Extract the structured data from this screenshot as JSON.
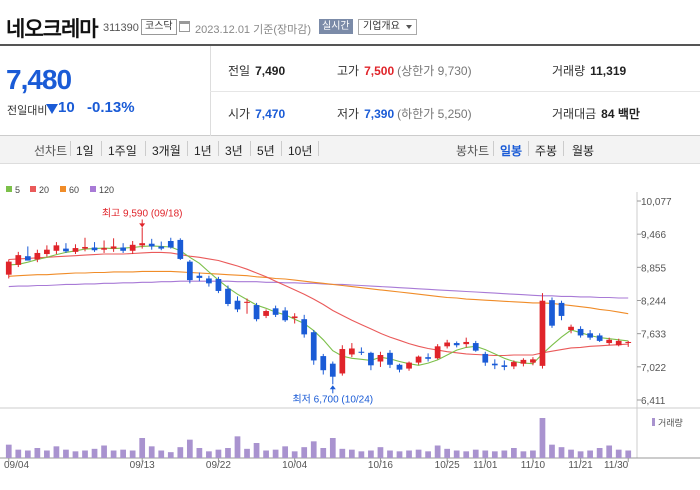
{
  "header": {
    "name": "네오크레마",
    "code": "311390",
    "market": "코스닥",
    "date": "2023.12.01 기준(장마감)",
    "realtime_label": "실시간",
    "corp_info_label": "기업개요"
  },
  "quote": {
    "price": "7,480",
    "change_label": "전일대비",
    "change": "10",
    "change_pct": "-0.13%",
    "direction": "down",
    "prev_close_label": "전일",
    "prev_close": "7,490",
    "high_label": "고가",
    "high": "7,500",
    "upper_limit": "(상한가 9,730)",
    "volume_label": "거래량",
    "volume": "11,319",
    "open_label": "시가",
    "open": "7,470",
    "low_label": "저가",
    "low": "7,390",
    "lower_limit": "(하한가 5,250)",
    "amount_label": "거래대금",
    "amount": "84 백만"
  },
  "period_bar": {
    "line_label": "선차트",
    "line_items": [
      "1일",
      "1주일",
      "3개월",
      "1년",
      "3년",
      "5년",
      "10년"
    ],
    "candle_label": "봉차트",
    "candle_items": [
      "일봉",
      "주봉",
      "월봉"
    ],
    "candle_active": "일봉"
  },
  "colors": {
    "up": "#e0242a",
    "down": "#1a5bd6",
    "ma5": "#7cc04a",
    "ma20": "#ea5a5a",
    "ma60": "#f08c28",
    "ma120": "#a87ad6",
    "volume": "#a993cf"
  },
  "chart_data": {
    "type": "candlestick",
    "legend": [
      {
        "name": "5",
        "color": "#7cc04a"
      },
      {
        "name": "20",
        "color": "#ea5a5a"
      },
      {
        "name": "60",
        "color": "#f08c28"
      },
      {
        "name": "120",
        "color": "#a87ad6"
      }
    ],
    "y_ticks": [
      "10,077",
      "9,466",
      "8,855",
      "8,244",
      "7,633",
      "7,022",
      "6,411"
    ],
    "ylim": [
      6411,
      10077
    ],
    "x_ticks": [
      "09/04",
      "09/13",
      "09/22",
      "10/04",
      "10/16",
      "10/25",
      "11/01",
      "11/10",
      "11/21",
      "11/30"
    ],
    "high_annotation": "최고 9,590 (09/18)",
    "low_annotation": "최저 6,700 (10/24)",
    "volume_label": "거래량",
    "candles": [
      {
        "o": 8720,
        "h": 9000,
        "l": 8650,
        "c": 8960
      },
      {
        "o": 8900,
        "h": 9140,
        "l": 8860,
        "c": 9080
      },
      {
        "o": 9060,
        "h": 9240,
        "l": 8980,
        "c": 8980
      },
      {
        "o": 9000,
        "h": 9180,
        "l": 8950,
        "c": 9120
      },
      {
        "o": 9100,
        "h": 9260,
        "l": 9050,
        "c": 9180
      },
      {
        "o": 9160,
        "h": 9320,
        "l": 9100,
        "c": 9260
      },
      {
        "o": 9200,
        "h": 9300,
        "l": 9120,
        "c": 9150
      },
      {
        "o": 9140,
        "h": 9280,
        "l": 9100,
        "c": 9210
      },
      {
        "o": 9200,
        "h": 9400,
        "l": 9150,
        "c": 9230
      },
      {
        "o": 9220,
        "h": 9320,
        "l": 9140,
        "c": 9170
      },
      {
        "o": 9180,
        "h": 9350,
        "l": 9120,
        "c": 9210
      },
      {
        "o": 9200,
        "h": 9390,
        "l": 9140,
        "c": 9240
      },
      {
        "o": 9220,
        "h": 9300,
        "l": 9120,
        "c": 9160
      },
      {
        "o": 9160,
        "h": 9340,
        "l": 9100,
        "c": 9270
      },
      {
        "o": 9260,
        "h": 9590,
        "l": 9200,
        "c": 9300
      },
      {
        "o": 9290,
        "h": 9380,
        "l": 9180,
        "c": 9240
      },
      {
        "o": 9240,
        "h": 9330,
        "l": 9170,
        "c": 9200
      },
      {
        "o": 9340,
        "h": 9400,
        "l": 9200,
        "c": 9220
      },
      {
        "o": 9360,
        "h": 9390,
        "l": 8990,
        "c": 9010
      },
      {
        "o": 8960,
        "h": 8990,
        "l": 8560,
        "c": 8620
      },
      {
        "o": 8700,
        "h": 8760,
        "l": 8600,
        "c": 8660
      },
      {
        "o": 8650,
        "h": 8700,
        "l": 8500,
        "c": 8560
      },
      {
        "o": 8640,
        "h": 8680,
        "l": 8380,
        "c": 8420
      },
      {
        "o": 8460,
        "h": 8520,
        "l": 8140,
        "c": 8180
      },
      {
        "o": 8240,
        "h": 8320,
        "l": 8030,
        "c": 8080
      },
      {
        "o": 8200,
        "h": 8280,
        "l": 8000,
        "c": 8220
      },
      {
        "o": 8160,
        "h": 8200,
        "l": 7860,
        "c": 7900
      },
      {
        "o": 7960,
        "h": 8080,
        "l": 7920,
        "c": 8050
      },
      {
        "o": 8100,
        "h": 8150,
        "l": 7940,
        "c": 7980
      },
      {
        "o": 8060,
        "h": 8120,
        "l": 7850,
        "c": 7880
      },
      {
        "o": 7920,
        "h": 8010,
        "l": 7820,
        "c": 7950
      },
      {
        "o": 7900,
        "h": 7980,
        "l": 7560,
        "c": 7620
      },
      {
        "o": 7660,
        "h": 7700,
        "l": 7060,
        "c": 7140
      },
      {
        "o": 7220,
        "h": 7260,
        "l": 6880,
        "c": 6960
      },
      {
        "o": 7080,
        "h": 7120,
        "l": 6700,
        "c": 6840
      },
      {
        "o": 6900,
        "h": 7420,
        "l": 6860,
        "c": 7350
      },
      {
        "o": 7250,
        "h": 7460,
        "l": 7200,
        "c": 7360
      },
      {
        "o": 7300,
        "h": 7380,
        "l": 7240,
        "c": 7280
      },
      {
        "o": 7280,
        "h": 7300,
        "l": 6960,
        "c": 7050
      },
      {
        "o": 7120,
        "h": 7300,
        "l": 7020,
        "c": 7240
      },
      {
        "o": 7280,
        "h": 7330,
        "l": 7000,
        "c": 7060
      },
      {
        "o": 7060,
        "h": 7080,
        "l": 6920,
        "c": 6970
      },
      {
        "o": 6990,
        "h": 7120,
        "l": 6950,
        "c": 7100
      },
      {
        "o": 7100,
        "h": 7230,
        "l": 7060,
        "c": 7210
      },
      {
        "o": 7200,
        "h": 7270,
        "l": 7120,
        "c": 7170
      },
      {
        "o": 7180,
        "h": 7440,
        "l": 7160,
        "c": 7400
      },
      {
        "o": 7400,
        "h": 7520,
        "l": 7360,
        "c": 7470
      },
      {
        "o": 7460,
        "h": 7490,
        "l": 7380,
        "c": 7420
      },
      {
        "o": 7440,
        "h": 7560,
        "l": 7380,
        "c": 7480
      },
      {
        "o": 7460,
        "h": 7500,
        "l": 7300,
        "c": 7320
      },
      {
        "o": 7260,
        "h": 7300,
        "l": 7040,
        "c": 7100
      },
      {
        "o": 7080,
        "h": 7160,
        "l": 6980,
        "c": 7050
      },
      {
        "o": 7050,
        "h": 7140,
        "l": 6960,
        "c": 7020
      },
      {
        "o": 7030,
        "h": 7140,
        "l": 6980,
        "c": 7110
      },
      {
        "o": 7080,
        "h": 7180,
        "l": 7030,
        "c": 7150
      },
      {
        "o": 7100,
        "h": 7200,
        "l": 7050,
        "c": 7160
      },
      {
        "o": 7040,
        "h": 8380,
        "l": 6990,
        "c": 8240
      },
      {
        "o": 8250,
        "h": 8300,
        "l": 7740,
        "c": 7780
      },
      {
        "o": 8200,
        "h": 8240,
        "l": 7880,
        "c": 7960
      },
      {
        "o": 7700,
        "h": 7800,
        "l": 7640,
        "c": 7760
      },
      {
        "o": 7720,
        "h": 7770,
        "l": 7560,
        "c": 7600
      },
      {
        "o": 7640,
        "h": 7700,
        "l": 7520,
        "c": 7560
      },
      {
        "o": 7600,
        "h": 7640,
        "l": 7480,
        "c": 7500
      },
      {
        "o": 7460,
        "h": 7560,
        "l": 7420,
        "c": 7520
      },
      {
        "o": 7420,
        "h": 7540,
        "l": 7400,
        "c": 7500
      },
      {
        "o": 7470,
        "h": 7500,
        "l": 7390,
        "c": 7480
      }
    ],
    "volumes": [
      16,
      10,
      9,
      12,
      9,
      14,
      10,
      8,
      9,
      11,
      15,
      9,
      10,
      9,
      24,
      14,
      9,
      7,
      13,
      22,
      12,
      8,
      10,
      12,
      26,
      11,
      18,
      9,
      10,
      14,
      8,
      13,
      20,
      12,
      24,
      11,
      10,
      8,
      9,
      13,
      9,
      8,
      9,
      10,
      8,
      15,
      11,
      9,
      8,
      10,
      9,
      8,
      9,
      12,
      8,
      9,
      48,
      16,
      13,
      10,
      8,
      9,
      12,
      15,
      10,
      9
    ],
    "ma5": [
      8900,
      8910,
      8950,
      9000,
      9040,
      9090,
      9130,
      9160,
      9190,
      9200,
      9210,
      9200,
      9210,
      9220,
      9240,
      9250,
      9240,
      9230,
      9160,
      9040,
      8930,
      8770,
      8620,
      8480,
      8360,
      8260,
      8160,
      8100,
      8030,
      7980,
      7900,
      7820,
      7690,
      7520,
      7320,
      7220,
      7180,
      7160,
      7140,
      7200,
      7170,
      7120,
      7080,
      7050,
      7090,
      7150,
      7240,
      7330,
      7380,
      7400,
      7340,
      7260,
      7180,
      7120,
      7090,
      7080,
      7260,
      7420,
      7570,
      7700,
      7650,
      7600,
      7560,
      7540,
      7520,
      7500
    ],
    "ma20": [
      9000,
      9010,
      9020,
      9030,
      9040,
      9050,
      9060,
      9070,
      9080,
      9090,
      9100,
      9100,
      9100,
      9110,
      9120,
      9130,
      9130,
      9120,
      9090,
      9060,
      9040,
      9010,
      8980,
      8930,
      8880,
      8820,
      8750,
      8680,
      8600,
      8520,
      8440,
      8360,
      8270,
      8170,
      8060,
      7970,
      7880,
      7800,
      7720,
      7640,
      7570,
      7510,
      7450,
      7400,
      7360,
      7330,
      7300,
      7280,
      7260,
      7250,
      7240,
      7230,
      7230,
      7240,
      7240,
      7240,
      7280,
      7310,
      7340,
      7370,
      7380,
      7400,
      7410,
      7420,
      7430,
      7440
    ],
    "ma60": [
      8690,
      8700,
      8710,
      8720,
      8720,
      8730,
      8740,
      8750,
      8750,
      8760,
      8760,
      8770,
      8770,
      8770,
      8780,
      8780,
      8780,
      8780,
      8770,
      8760,
      8750,
      8740,
      8730,
      8720,
      8710,
      8700,
      8680,
      8670,
      8650,
      8640,
      8620,
      8600,
      8580,
      8560,
      8540,
      8520,
      8500,
      8480,
      8460,
      8440,
      8420,
      8400,
      8380,
      8360,
      8340,
      8320,
      8300,
      8290,
      8270,
      8260,
      8250,
      8240,
      8230,
      8220,
      8210,
      8200,
      8200,
      8190,
      8170,
      8150,
      8130,
      8110,
      8080,
      8060,
      8030,
      8000
    ],
    "ma120": [
      8500,
      8510,
      8510,
      8520,
      8520,
      8530,
      8540,
      8540,
      8550,
      8550,
      8560,
      8560,
      8570,
      8570,
      8580,
      8580,
      8590,
      8590,
      8600,
      8600,
      8600,
      8600,
      8600,
      8600,
      8590,
      8590,
      8590,
      8580,
      8580,
      8570,
      8570,
      8560,
      8560,
      8550,
      8540,
      8540,
      8530,
      8520,
      8510,
      8500,
      8490,
      8480,
      8470,
      8460,
      8450,
      8440,
      8430,
      8420,
      8410,
      8400,
      8390,
      8380,
      8370,
      8360,
      8350,
      8340,
      8330,
      8330,
      8320,
      8320,
      8310,
      8310,
      8300,
      8300,
      8290,
      8290
    ]
  }
}
